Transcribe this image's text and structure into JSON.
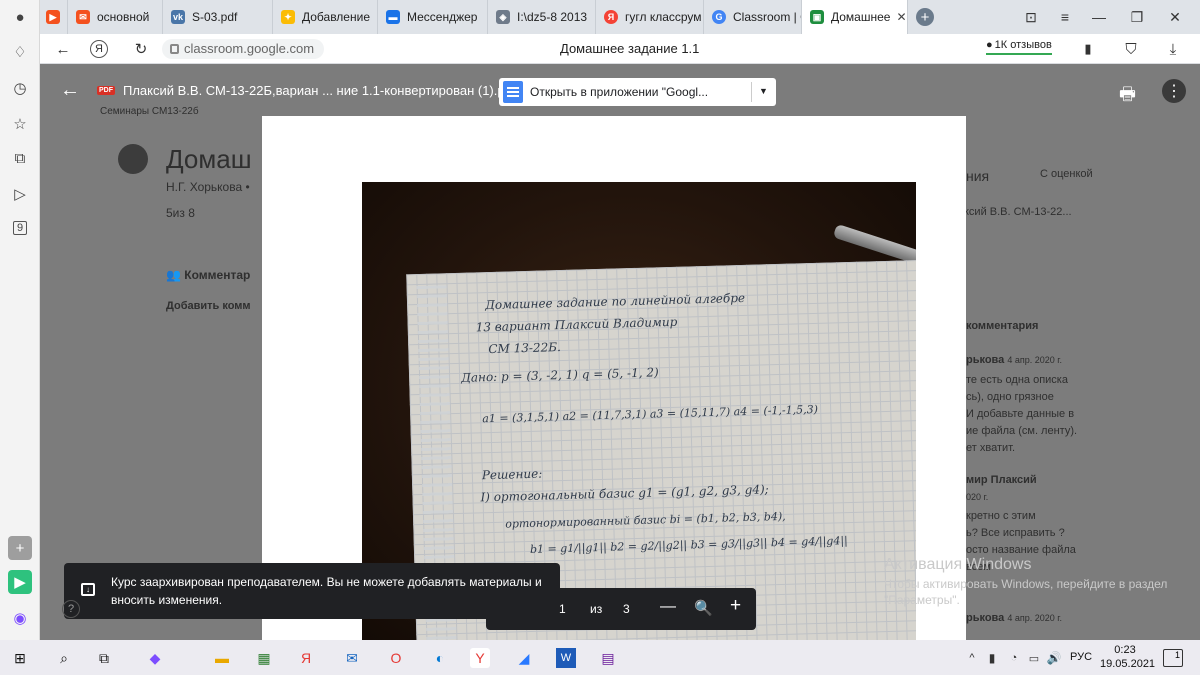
{
  "sidebar": {
    "badge_number": "9"
  },
  "tabs": [
    {
      "label": "основной",
      "icon": "yandex-mail-icon",
      "color": "#f4511e"
    },
    {
      "label": "S-03.pdf",
      "icon": "vk-icon",
      "color": "#4a76a8"
    },
    {
      "label": "Добавление",
      "icon": "puzzle-icon",
      "color": "#fbbc05"
    },
    {
      "label": "Мессенджер",
      "icon": "messenger-icon",
      "color": "#1a73e8"
    },
    {
      "label": "I:\\dz5-8 2013",
      "icon": "shield-icon",
      "color": "#6f7b8a"
    },
    {
      "label": "гугл классрум",
      "icon": "yandex-icon",
      "color": "#f44336"
    },
    {
      "label": "Classroom | G",
      "icon": "google-icon",
      "color": "#4285f4"
    },
    {
      "label": "Домашнее",
      "icon": "classroom-icon",
      "color": "#1e8e3e",
      "active": true
    }
  ],
  "addressbar": {
    "url": "classroom.google.com",
    "page_title": "Домашнее задание 1.1",
    "reviews": "1К отзывов"
  },
  "classroom": {
    "assignment_title": "Домаш",
    "teacher": "Н.Г. Хорькова •",
    "points": "5из 8",
    "comments_header": "Комментар",
    "add_comment": "Добавить комм",
    "breadcrumb": "Семинары СМ13-22б",
    "right_tab_1": "ния",
    "right_tab_2": "С оценкой",
    "right_student": "ксий В.В. СМ-13-22...",
    "right_comments": "комментария",
    "comment1_author": "рькова",
    "comment1_date": "4 апр. 2020 г.",
    "comment1_lines": [
      "те есть одна описка",
      "сь), одно грязное",
      "И добавьте данные в",
      "ие файла (см. ленту).",
      "ет хватит."
    ],
    "comment2_author": "мир Плаксий",
    "comment2_date": "020 г.",
    "comment2_lines": [
      "кретно с этим",
      "ь? Все исправить ?",
      "осто название файла",
      "всем"
    ],
    "comment3_author": "рькова",
    "comment3_date": "4 апр. 2020 г."
  },
  "viewer": {
    "file_title": "Плаксий В.В. СМ-13-22Б,вариан ... ние 1.1-конвертирован (1).pdf",
    "pdf_badge": "PDF",
    "open_in_app": "Открыть в приложении \"Googl..."
  },
  "handwriting": {
    "line1": "Домашнее задание по линейной алгебре",
    "line2": "13 вариант  Плаксий Владимир",
    "line3": "СМ 13-22Б.",
    "line4": "Дано: p = (3, -2, 1)   q = (5, -1, 2)",
    "line5": "a1 = (3,1,5,1)   a2 = (11,7,3,1)   a3 = (15,11,7)   a4 = (-1,-1,5,3)",
    "line6": "Решение:",
    "line7": "I) ортогональный базис  g1 = (g1, g2, g3, g4);",
    "line8": "ортонормированный базис  bi = (b1, b2, b3, b4),",
    "line9": "b1 = g1/||g1||   b2 = g2/||g2||   b3 = g3/||g3||   b4 = g4/||g4||"
  },
  "toast": {
    "text": "Курс заархивирован преподавателем. Вы не можете добавлять материалы и вносить изменения."
  },
  "page_controls": {
    "current": "1",
    "of": "из",
    "total": "3",
    "zoom_out": "—",
    "zoom_in": "+"
  },
  "windows_watermark": {
    "title": "Активация Windows",
    "text": "Чтобы активировать Windows, перейдите в раздел \"Параметры\"."
  },
  "taskbar": {
    "language": "РУС",
    "time": "0:23",
    "date": "19.05.2021",
    "notifications": "1"
  }
}
